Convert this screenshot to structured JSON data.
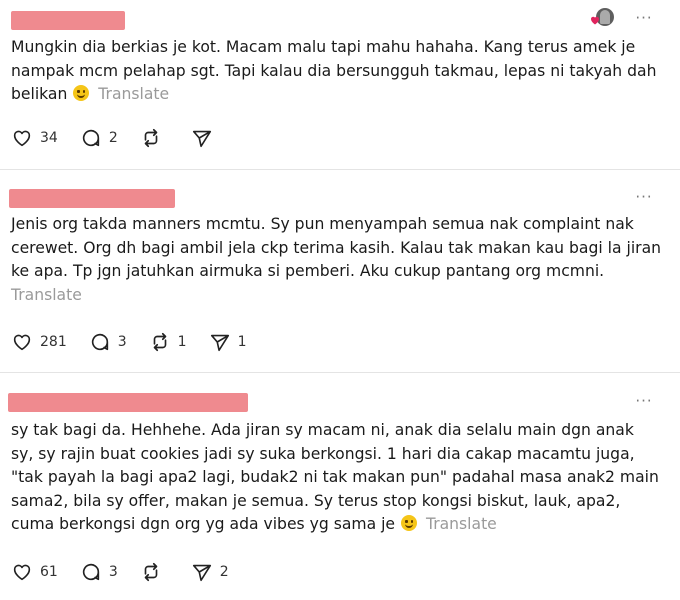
{
  "posts": [
    {
      "text": "Mungkin dia berkias je kot. Macam malu tapi mahu hahaha. Kang terus amek je nampak mcm pelahap sgt. Tapi kalau dia bersungguh takmau, lepas ni takyah dah belikan",
      "emoji": "laughing-face",
      "translate": "Translate",
      "likes": "34",
      "replies": "2",
      "reposts": "",
      "shares": ""
    },
    {
      "text": "Jenis org takda manners mcmtu. Sy pun menyampah semua nak complaint nak cerewet. Org dh bagi ambil jela ckp terima kasih. Kalau tak makan kau bagi la jiran ke apa. Tp jgn jatuhkan airmuka si pemberi. Aku cukup pantang org mcmni.",
      "translate": "Translate",
      "likes": "281",
      "replies": "3",
      "reposts": "1",
      "shares": "1"
    },
    {
      "text": "sy tak bagi da. Hehhehe. Ada jiran sy macam ni, anak dia selalu main dgn anak sy, sy rajin buat cookies jadi sy suka berkongsi. 1 hari dia cakap macamtu juga, \"tak payah la bagi apa2 lagi, budak2 ni tak makan pun\" padahal masa anak2 main sama2, bila sy offer, makan je semua. Sy terus stop kongsi biskut, lauk, apa2, cuma berkongsi dgn org yg ada vibes yg sama je",
      "emoji": "smiling-face",
      "translate": "Translate",
      "likes": "61",
      "replies": "3",
      "reposts": "",
      "shares": "2"
    }
  ],
  "more_label": "···",
  "colors": {
    "redaction": "#ef8a8f",
    "text": "#1a1a1a",
    "muted": "#9a9a9a",
    "divider": "#e4e4e4",
    "heart": "#e0245e"
  }
}
